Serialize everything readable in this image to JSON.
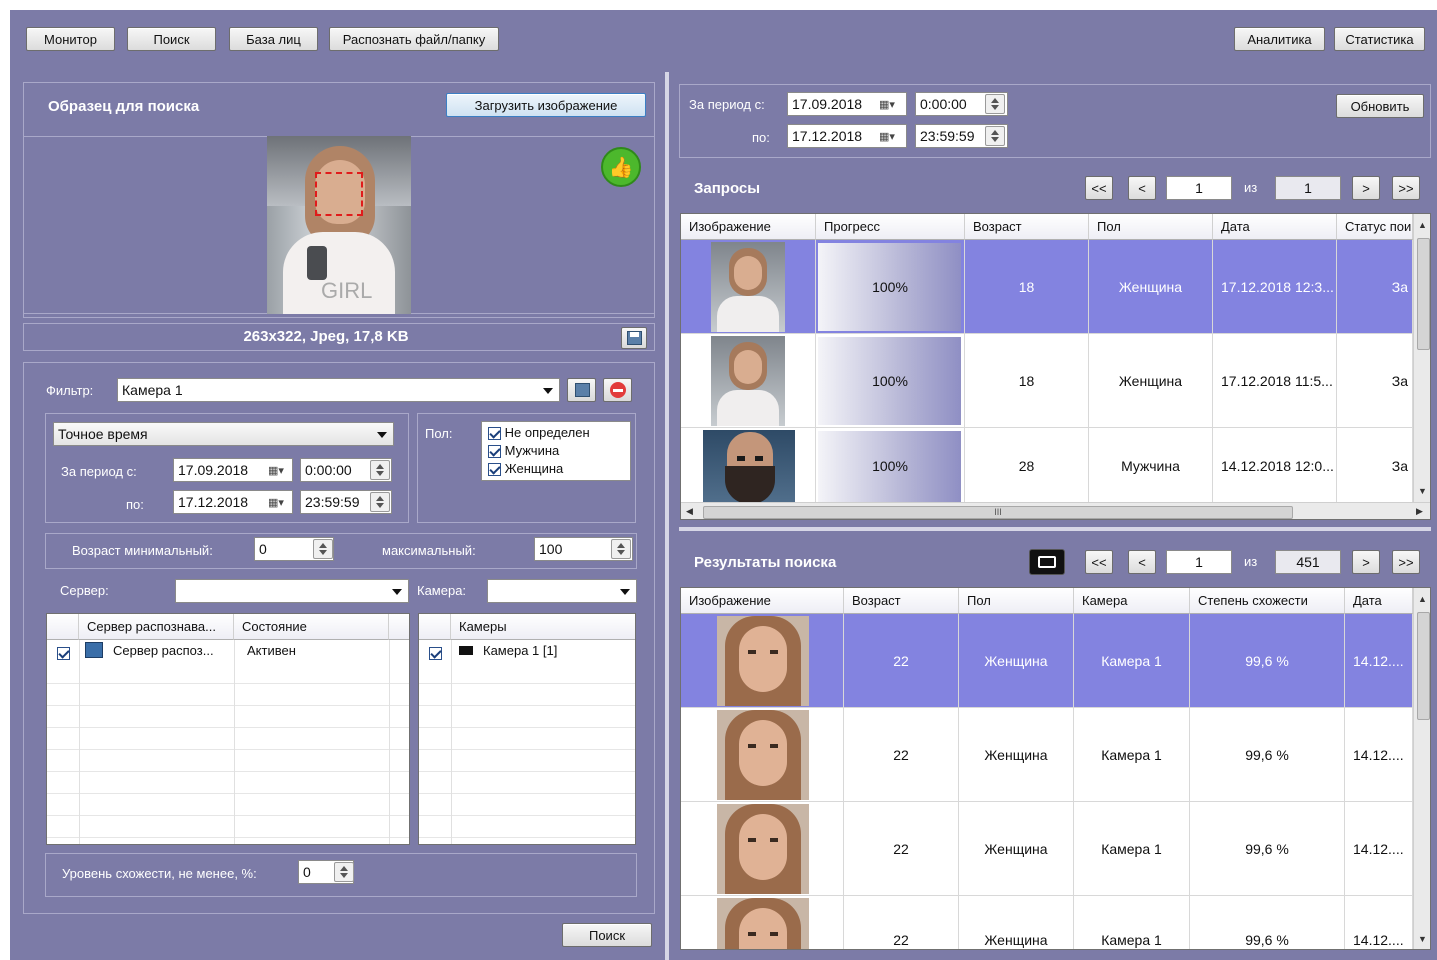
{
  "toolbar": {
    "monitor": "Монитор",
    "search": "Поиск",
    "face_db": "База лиц",
    "recognize_file": "Распознать файл/папку",
    "analytics": "Аналитика",
    "statistics": "Статистика"
  },
  "sample": {
    "title": "Образец для поиска",
    "load_button": "Загрузить изображение",
    "image_info": "263x322, Jpeg, 17,8 KB"
  },
  "filter": {
    "label": "Фильтр:",
    "value": "Камера 1",
    "time_mode": "Точное время",
    "period_from_label": "За период с:",
    "period_to_label": "по:",
    "date_from": "17.09.2018",
    "time_from": "0:00:00",
    "date_to": "17.12.2018",
    "time_to": "23:59:59",
    "gender_label": "Пол:",
    "genders": [
      "Не определен",
      "Мужчина",
      "Женщина"
    ],
    "age_min_label": "Возраст минимальный:",
    "age_min": "0",
    "age_max_label": "максимальный:",
    "age_max": "100",
    "server_label": "Сервер:",
    "camera_label": "Камера:",
    "server_table": {
      "headers": [
        "Сервер распознава...",
        "Состояние"
      ],
      "rows": [
        {
          "name": "Сервер распоз...",
          "state": "Активен"
        }
      ]
    },
    "camera_table": {
      "header": "Камеры",
      "rows": [
        "Камера 1 [1]"
      ]
    },
    "similarity_label": "Уровень схожести, не менее, %:",
    "similarity": "0",
    "search_button": "Поиск"
  },
  "requests": {
    "period_from_label": "За период с:",
    "period_to_label": "по:",
    "date_from": "17.09.2018",
    "time_from": "0:00:00",
    "date_to": "17.12.2018",
    "time_to": "23:59:59",
    "refresh": "Обновить",
    "title": "Запросы",
    "pager": {
      "first": "<<",
      "prev": "<",
      "page": "1",
      "of": "из",
      "total": "1",
      "next": ">",
      "last": ">>"
    },
    "headers": [
      "Изображение",
      "Прогресс",
      "Возраст",
      "Пол",
      "Дата",
      "Статус пои"
    ],
    "rows": [
      {
        "progress": "100%",
        "progress_value": 1.0,
        "age": "18",
        "gender": "Женщина",
        "date": "17.12.2018 12:3...",
        "status": "За"
      },
      {
        "progress": "100%",
        "progress_value": 1.0,
        "age": "18",
        "gender": "Женщина",
        "date": "17.12.2018 11:5...",
        "status": "За"
      },
      {
        "progress": "100%",
        "progress_value": 1.0,
        "age": "28",
        "gender": "Мужчина",
        "date": "14.12.2018 12:0...",
        "status": "За"
      }
    ],
    "scroll_grip": "III"
  },
  "results": {
    "title": "Результаты поиска",
    "pager": {
      "first": "<<",
      "prev": "<",
      "page": "1",
      "of": "из",
      "total": "451",
      "next": ">",
      "last": ">>"
    },
    "headers": [
      "Изображение",
      "Возраст",
      "Пол",
      "Камера",
      "Степень схожести",
      "Дата"
    ],
    "rows": [
      {
        "age": "22",
        "gender": "Женщина",
        "camera": "Камера 1",
        "similarity": "99,6 %",
        "date": "14.12...."
      },
      {
        "age": "22",
        "gender": "Женщина",
        "camera": "Камера 1",
        "similarity": "99,6 %",
        "date": "14.12...."
      },
      {
        "age": "22",
        "gender": "Женщина",
        "camera": "Камера 1",
        "similarity": "99,6 %",
        "date": "14.12...."
      },
      {
        "age": "22",
        "gender": "Женщина",
        "camera": "Камера 1",
        "similarity": "99,6 %",
        "date": "14.12...."
      }
    ]
  },
  "colors": {
    "background": "#7c7ba7",
    "selection": "#8383e0",
    "accept_green": "#4cb82c"
  }
}
